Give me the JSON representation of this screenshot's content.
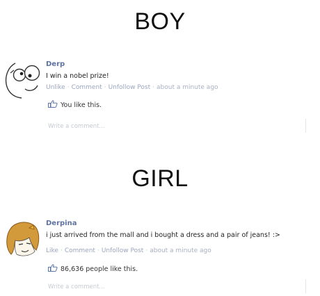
{
  "boy": {
    "title": "BOY",
    "post": {
      "name": "Derp",
      "text": "I win a nobel prize!",
      "actions": [
        "Unlike",
        "Comment",
        "Unfollow Post"
      ],
      "time": "about a minute ago",
      "likes": "You like this.",
      "comment_placeholder": "Write a comment..."
    }
  },
  "girl": {
    "title": "GIRL",
    "post": {
      "name": "Derpina",
      "text": "i just arrived from the mall and i bought a dress and a pair of jeans! :>",
      "actions": [
        "Like",
        "Comment",
        "Unfollow Post"
      ],
      "time": "about a minute ago",
      "likes": "86,636 people like this.",
      "comment_placeholder": "Write a comment..."
    }
  },
  "colors": {
    "link": "#5d72a0",
    "muted": "#9aa6bf",
    "thumb": "#5b74a8"
  },
  "icons": [
    "derp-face-icon",
    "derpina-face-icon",
    "thumbs-up-icon"
  ]
}
